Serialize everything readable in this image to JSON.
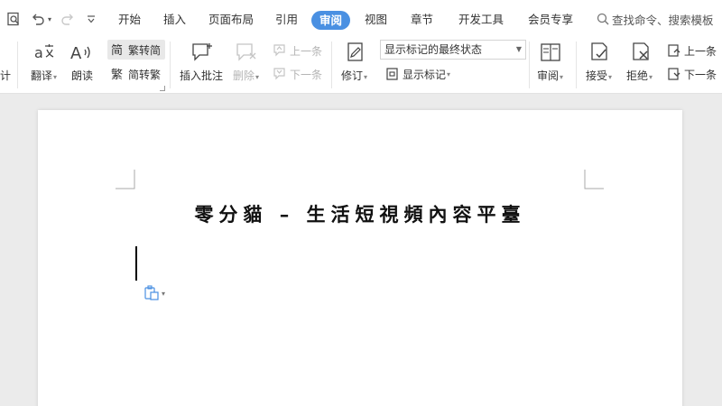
{
  "menubar": {
    "tabs": [
      "开始",
      "插入",
      "页面布局",
      "引用",
      "审阅",
      "视图",
      "章节",
      "开发工具",
      "会员专享"
    ],
    "active_tab": "审阅",
    "search_text": "查找命令、搜索模板"
  },
  "ribbon": {
    "left_cut_label": "计",
    "translate": "翻译",
    "read_aloud": "朗读",
    "trad_simp": "繁转简",
    "simp_trad": "简转繁",
    "insert_comment": "插入批注",
    "delete": "删除",
    "prev_comment": "上一条",
    "next_comment": "下一条",
    "revise": "修订",
    "markup_mode": "显示标记的最终状态",
    "show_markup": "显示标记",
    "review": "审阅",
    "accept": "接受",
    "reject": "拒绝",
    "prev_change": "上一条",
    "next_change": "下一条"
  },
  "document": {
    "title": "零分貓 – 生活短視頻內容平臺"
  },
  "colors": {
    "accent": "#4a90e2",
    "page": "#ffffff",
    "canvas": "#ebebeb"
  }
}
